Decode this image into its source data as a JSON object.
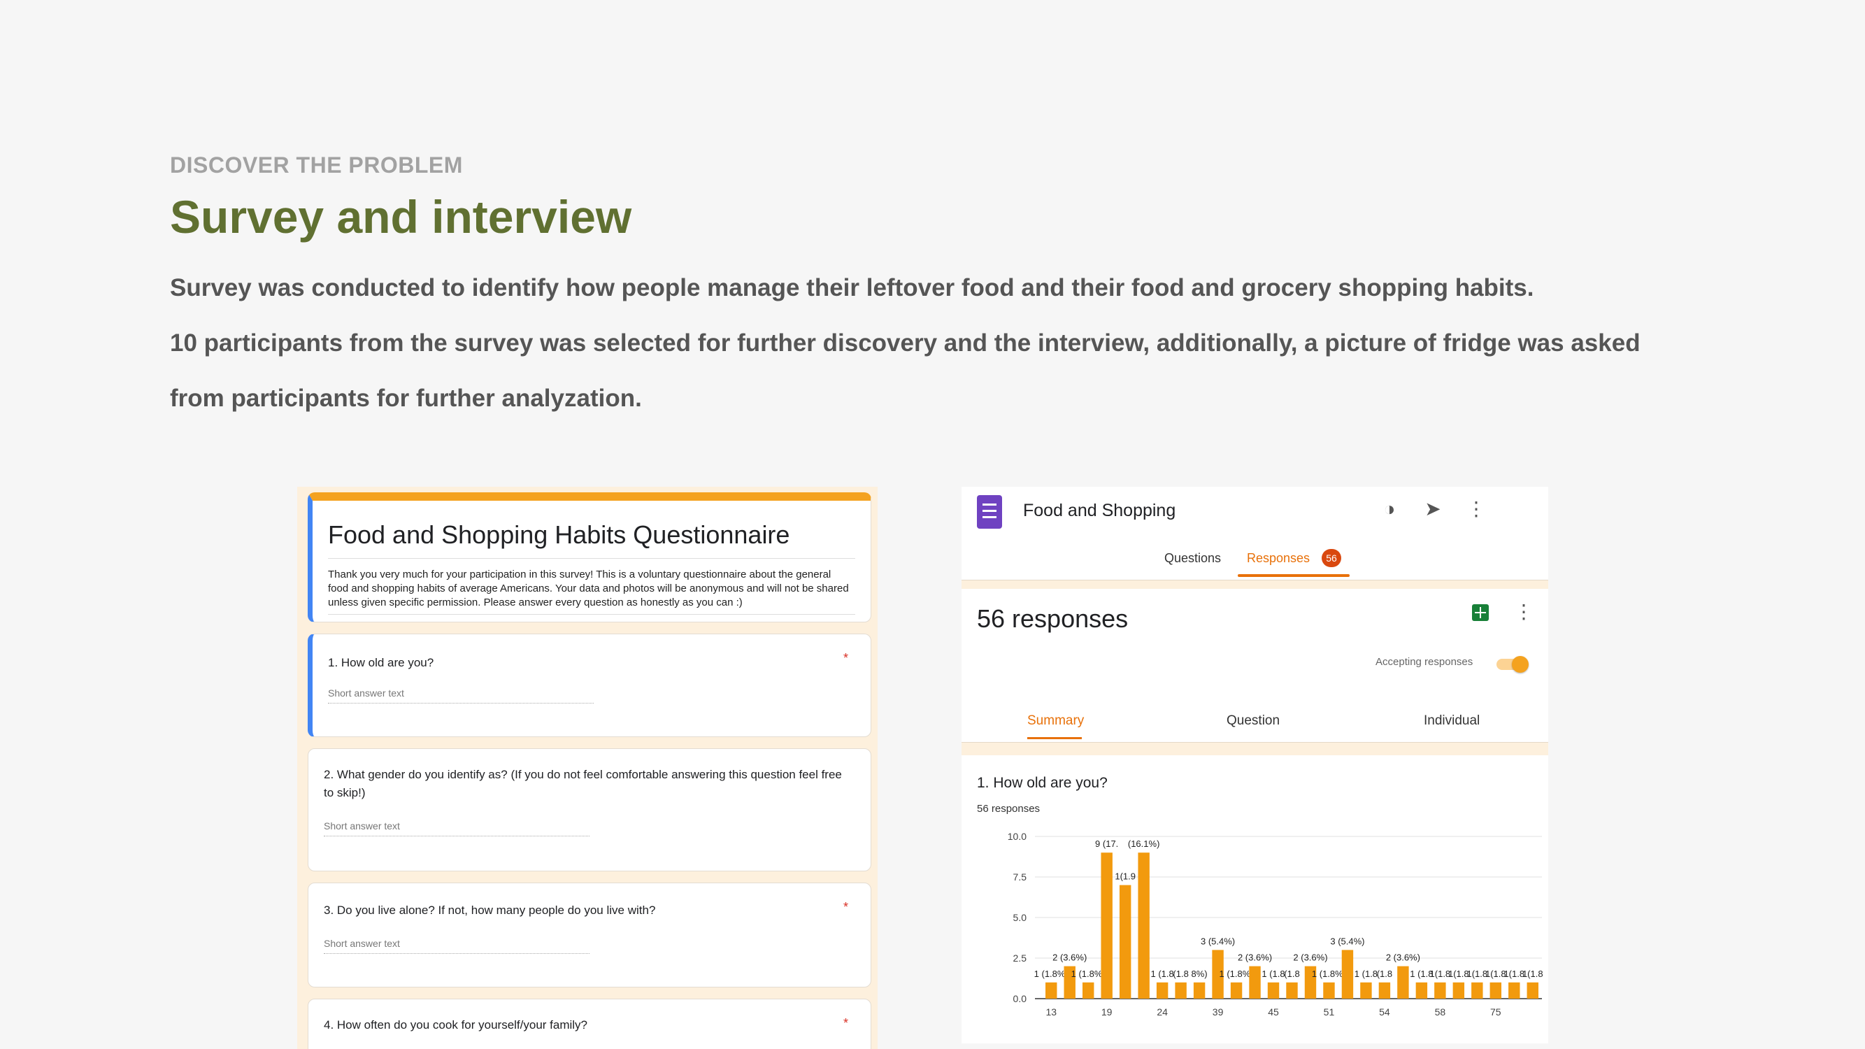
{
  "header": {
    "eyebrow": "DISCOVER THE PROBLEM",
    "title": "Survey and interview",
    "line1": "Survey was conducted to identify how people manage their leftover food and their food and grocery shopping habits.",
    "line2": "10 participants from the survey was selected for further discovery and the interview, additionally, a picture of fridge was asked",
    "line3": "from participants for further analyzation."
  },
  "form": {
    "title": "Food and Shopping Habits Questionnaire",
    "description": "Thank you very much for your participation in this survey! This is a voluntary questionnaire about the general food and shopping habits of average Americans. Your data and photos will be anonymous and will not be shared unless given specific permission. Please answer every question as honestly as you can :)",
    "short_answer": "Short answer text",
    "required_mark": "*",
    "questions": [
      {
        "label": "1. How old are you?"
      },
      {
        "label": "2. What gender do you identify as? (If you do not feel comfortable answering this question feel free to skip!)"
      },
      {
        "label": "3. Do you live alone? If not, how many  people do you live with?"
      },
      {
        "label": "4. How often do you cook for yourself/your family?"
      }
    ]
  },
  "responses": {
    "form_name": "Food and Shopping",
    "tabs": {
      "questions": "Questions",
      "responses": "Responses",
      "badge": "56"
    },
    "count_title": "56 responses",
    "accepting": "Accepting responses",
    "accepting_on": true,
    "subtabs": {
      "summary": "Summary",
      "question": "Question",
      "individual": "Individual"
    },
    "question_title": "1. How old are you?",
    "question_sub": "56 responses",
    "icons": [
      "form-icon",
      "palette-icon",
      "send-icon",
      "more-vert-icon",
      "sheets-icon"
    ]
  },
  "colors": {
    "bar": "#f29a0e",
    "accent": "#e8710a",
    "headline": "#607031"
  },
  "chart_data": {
    "type": "bar",
    "ylim": [
      0,
      10
    ],
    "yticks": [
      "0.0",
      "2.5",
      "5.0",
      "7.5",
      "10.0"
    ],
    "xticks": [
      "13",
      "19",
      "24",
      "39",
      "45",
      "51",
      "54",
      "58",
      "75"
    ],
    "values": [
      1,
      2,
      1,
      9,
      7,
      9,
      1,
      1,
      1,
      3,
      1,
      2,
      1,
      1,
      2,
      1,
      3,
      1,
      1,
      2,
      1,
      1,
      1,
      1,
      1,
      1,
      1
    ],
    "labels": [
      "1 (1.8%)",
      "2 (3.6%)",
      "1 (1.8%)",
      "9 (17.",
      "1(1.9",
      "(16.1%)",
      "1 (1.8",
      "(1.8",
      "8%)",
      "3 (5.4%)",
      "1 (1.8%)",
      "2 (3.6%)",
      "1 (1.8",
      "(1.8",
      "2 (3.6%)",
      "1 (1.8%)",
      "3 (5.4%)",
      "1 (1.8",
      "(1.8",
      "2 (3.6%)",
      "1 (1.8",
      "1(1.8",
      "1(1.8",
      "1(1.8",
      "1(1.8",
      "1(1.8",
      "1(1.8"
    ]
  }
}
